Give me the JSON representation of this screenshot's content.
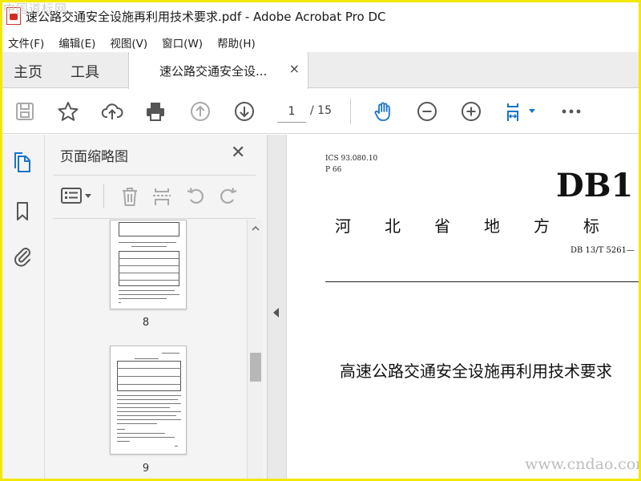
{
  "window": {
    "title": "速公路交通安全设施再利用技术要求.pdf - Adobe Acrobat Pro DC",
    "watermark_top": "中国道标网",
    "watermark_bottom": "www.cndao.com"
  },
  "menu": [
    "文件(F)",
    "编辑(E)",
    "视图(V)",
    "窗口(W)",
    "帮助(H)"
  ],
  "tabs": {
    "home": "主页",
    "tools": "工具",
    "document": "速公路交通安全设...",
    "close": "×"
  },
  "toolbar": {
    "current_page": "1",
    "total_pages": "/ 15"
  },
  "panel": {
    "title": "页面缩略图",
    "close": "✕",
    "thumbnails": [
      {
        "label": "8"
      },
      {
        "label": "9"
      }
    ]
  },
  "document": {
    "ics": "ICS 93.080.10",
    "p_code": "P 66",
    "logo": "DB1",
    "region": "河北省地方标",
    "doc_number": "DB 13/T 5261—",
    "title": "高速公路交通安全设施再利用技术要求"
  },
  "colors": {
    "accent_blue": "#1a73c8",
    "frame_yellow": "#f2e800",
    "icon_gray": "#555555",
    "disabled_gray": "#a9a9a9"
  }
}
